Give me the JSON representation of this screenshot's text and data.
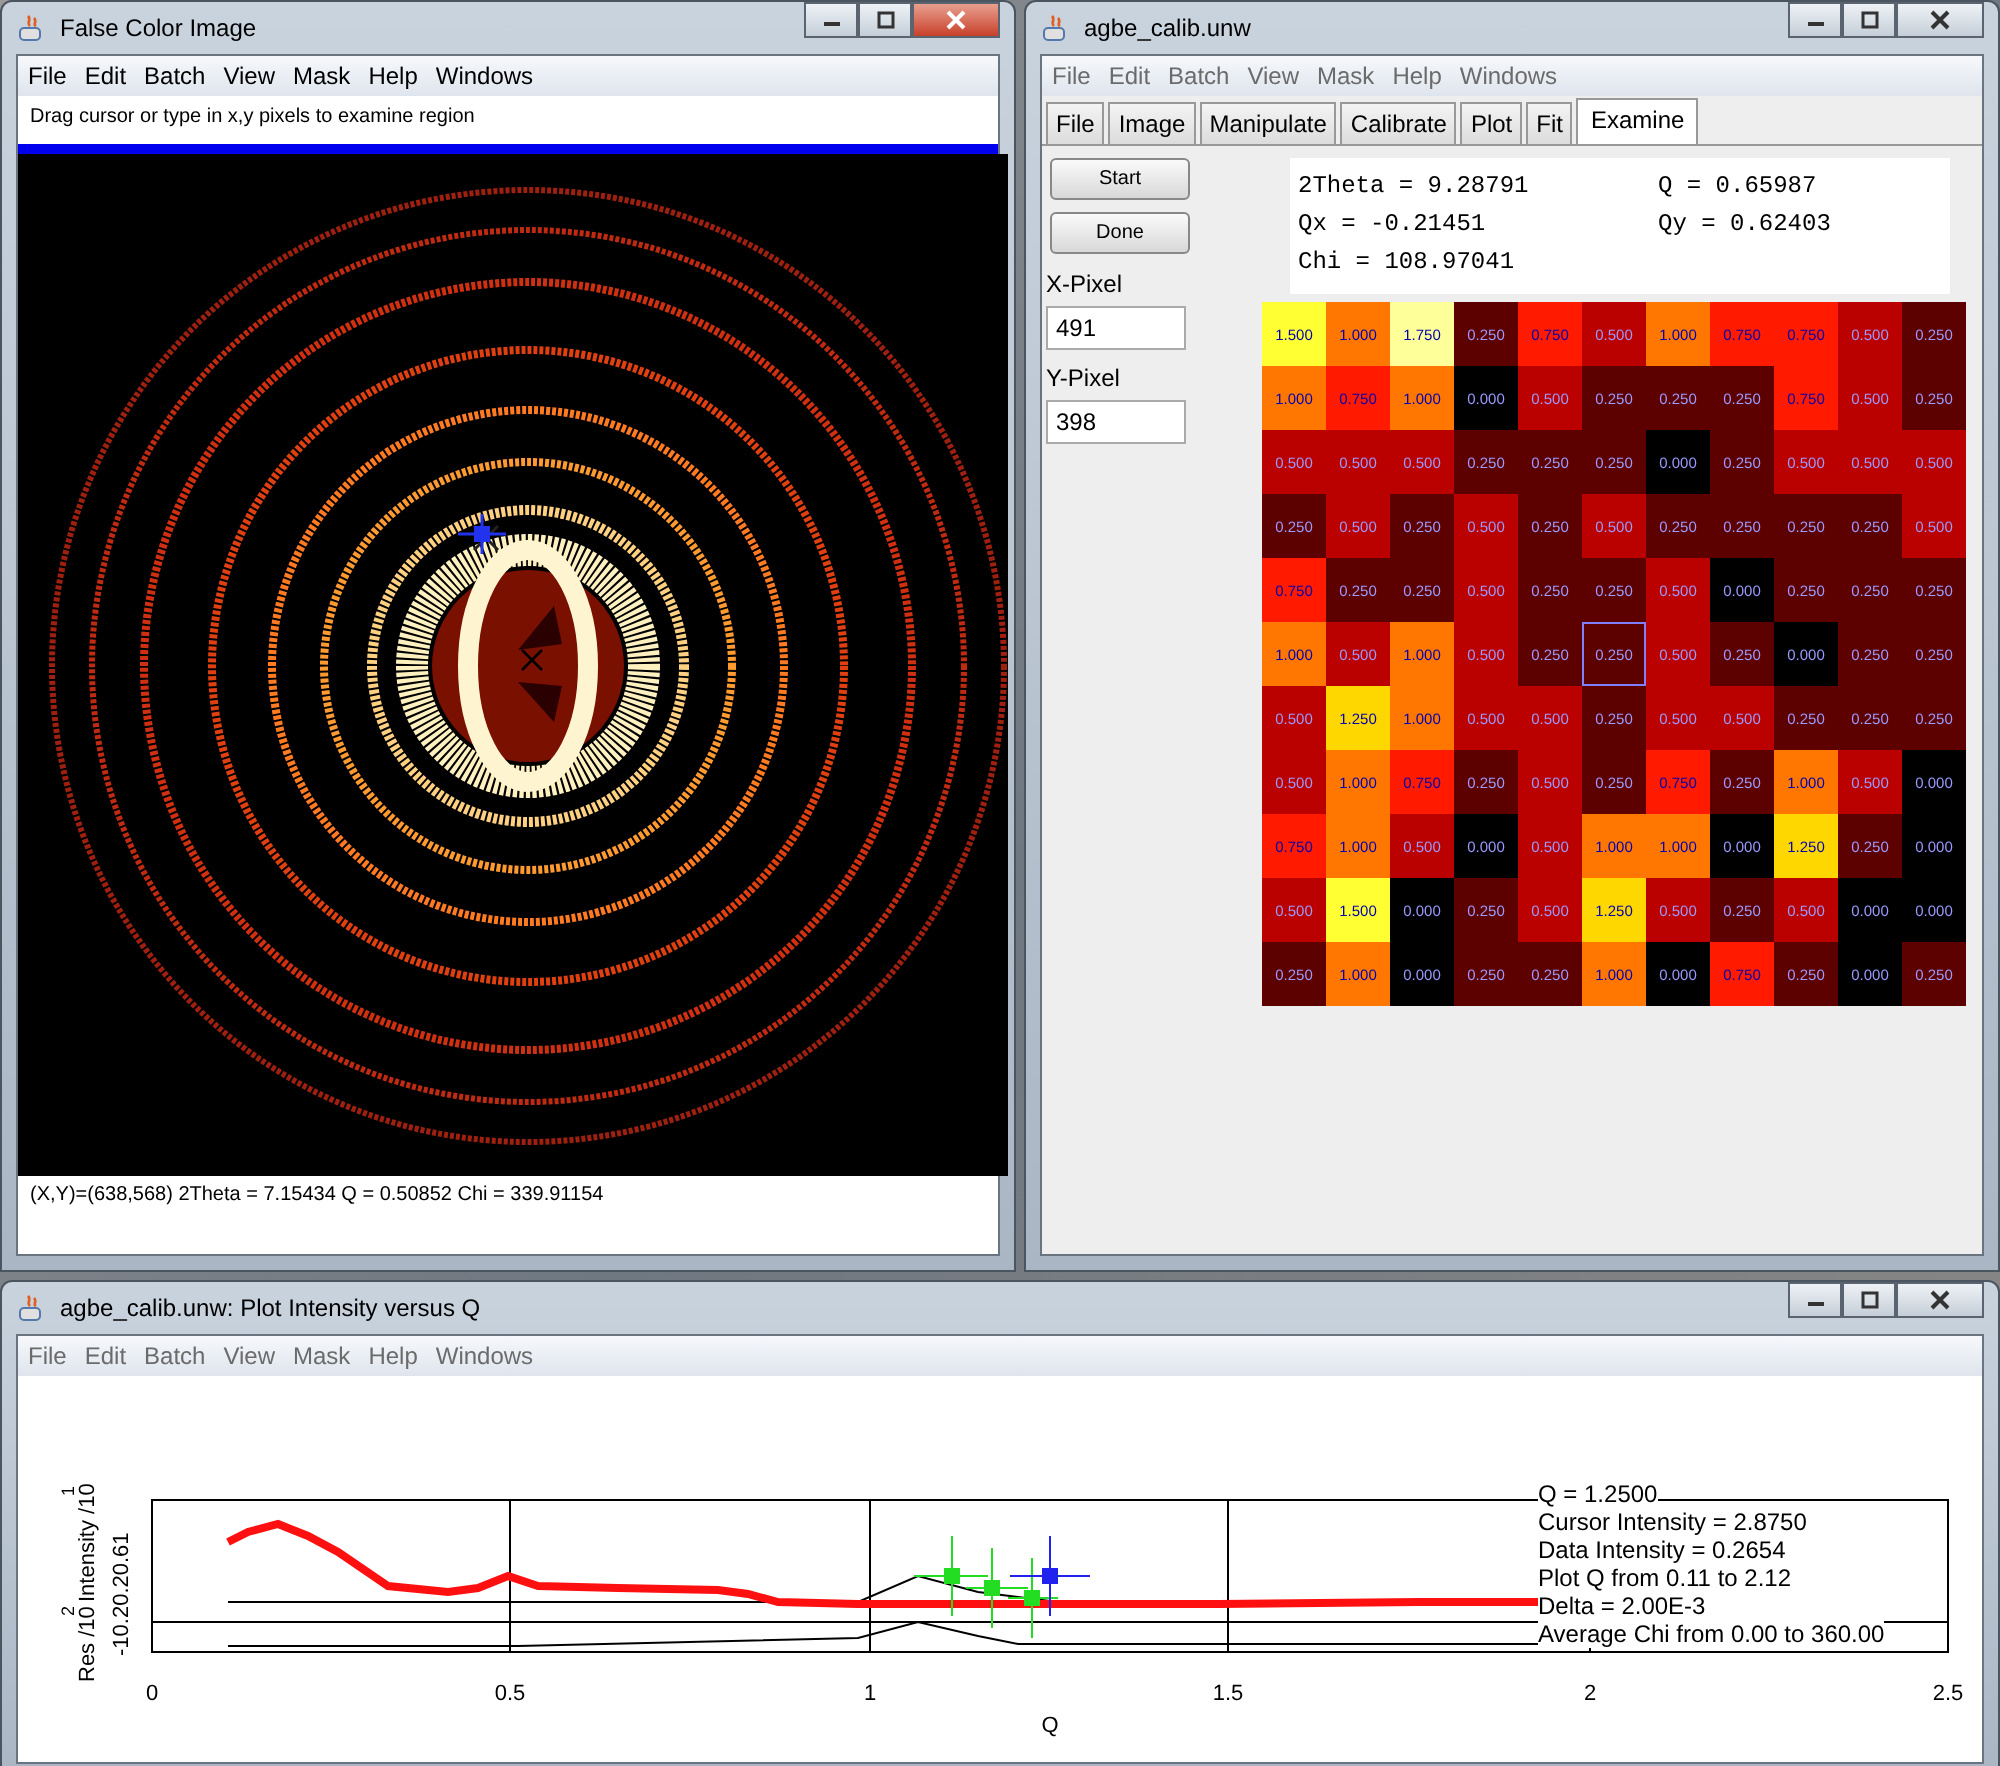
{
  "image_window": {
    "title": "False Color Image",
    "active": true,
    "menu": [
      "File",
      "Edit",
      "Batch",
      "View",
      "Mask",
      "Help",
      "Windows"
    ],
    "hint": "Drag cursor or type in x,y pixels to examine region",
    "status": "(X,Y)=(638,568)  2Theta = 7.15434 Q = 0.50852 Chi = 339.91154"
  },
  "examine_window": {
    "title": "agbe_calib.unw",
    "active": false,
    "menu": [
      "File",
      "Edit",
      "Batch",
      "View",
      "Mask",
      "Help",
      "Windows"
    ],
    "tabs": [
      {
        "label": "File",
        "selected": false
      },
      {
        "label": "Image",
        "selected": false
      },
      {
        "label": "Manipulate",
        "selected": false
      },
      {
        "label": "Calibrate",
        "selected": false
      },
      {
        "label": "Plot",
        "selected": false
      },
      {
        "label": "Fit",
        "selected": false
      },
      {
        "label": "Examine",
        "selected": true
      }
    ],
    "buttons": [
      "Start",
      "Done"
    ],
    "fields": [
      {
        "label": "X-Pixel",
        "value": "491"
      },
      {
        "label": "Y-Pixel",
        "value": "398"
      }
    ],
    "readout": [
      [
        "2Theta = 9.28791",
        "Q = 0.65987"
      ],
      [
        "Qx = -0.21451",
        "Qy = 0.62403"
      ],
      [
        "Chi = 108.97041"
      ]
    ],
    "grid": [
      [
        {
          "value": "1.500",
          "selected": false
        },
        {
          "value": "1.000",
          "selected": false
        },
        {
          "value": "1.750",
          "selected": false
        },
        {
          "value": "0.250",
          "selected": false
        },
        {
          "value": "0.750",
          "selected": false
        },
        {
          "value": "0.500",
          "selected": false
        },
        {
          "value": "1.000",
          "selected": false
        },
        {
          "value": "0.750",
          "selected": false
        },
        {
          "value": "0.750",
          "selected": false
        },
        {
          "value": "0.500",
          "selected": false
        },
        {
          "value": "0.250",
          "selected": false
        }
      ],
      [
        {
          "value": "1.000",
          "selected": false
        },
        {
          "value": "0.750",
          "selected": false
        },
        {
          "value": "1.000",
          "selected": false
        },
        {
          "value": "0.000",
          "selected": false
        },
        {
          "value": "0.500",
          "selected": false
        },
        {
          "value": "0.250",
          "selected": false
        },
        {
          "value": "0.250",
          "selected": false
        },
        {
          "value": "0.250",
          "selected": false
        },
        {
          "value": "0.750",
          "selected": false
        },
        {
          "value": "0.500",
          "selected": false
        },
        {
          "value": "0.250",
          "selected": false
        }
      ],
      [
        {
          "value": "0.500",
          "selected": false
        },
        {
          "value": "0.500",
          "selected": false
        },
        {
          "value": "0.500",
          "selected": false
        },
        {
          "value": "0.250",
          "selected": false
        },
        {
          "value": "0.250",
          "selected": false
        },
        {
          "value": "0.250",
          "selected": false
        },
        {
          "value": "0.000",
          "selected": false
        },
        {
          "value": "0.250",
          "selected": false
        },
        {
          "value": "0.500",
          "selected": false
        },
        {
          "value": "0.500",
          "selected": false
        },
        {
          "value": "0.500",
          "selected": false
        }
      ],
      [
        {
          "value": "0.250",
          "selected": false
        },
        {
          "value": "0.500",
          "selected": false
        },
        {
          "value": "0.250",
          "selected": false
        },
        {
          "value": "0.500",
          "selected": false
        },
        {
          "value": "0.250",
          "selected": false
        },
        {
          "value": "0.500",
          "selected": false
        },
        {
          "value": "0.250",
          "selected": false
        },
        {
          "value": "0.250",
          "selected": false
        },
        {
          "value": "0.250",
          "selected": false
        },
        {
          "value": "0.250",
          "selected": false
        },
        {
          "value": "0.500",
          "selected": false
        }
      ],
      [
        {
          "value": "0.750",
          "selected": false
        },
        {
          "value": "0.250",
          "selected": false
        },
        {
          "value": "0.250",
          "selected": false
        },
        {
          "value": "0.500",
          "selected": false
        },
        {
          "value": "0.250",
          "selected": false
        },
        {
          "value": "0.250",
          "selected": false
        },
        {
          "value": "0.500",
          "selected": false
        },
        {
          "value": "0.000",
          "selected": false
        },
        {
          "value": "0.250",
          "selected": false
        },
        {
          "value": "0.250",
          "selected": false
        },
        {
          "value": "0.250",
          "selected": false
        }
      ],
      [
        {
          "value": "1.000",
          "selected": false
        },
        {
          "value": "0.500",
          "selected": false
        },
        {
          "value": "1.000",
          "selected": false
        },
        {
          "value": "0.500",
          "selected": false
        },
        {
          "value": "0.250",
          "selected": false
        },
        {
          "value": "0.250",
          "selected": true
        },
        {
          "value": "0.500",
          "selected": false
        },
        {
          "value": "0.250",
          "selected": false
        },
        {
          "value": "0.000",
          "selected": false
        },
        {
          "value": "0.250",
          "selected": false
        },
        {
          "value": "0.250",
          "selected": false
        }
      ],
      [
        {
          "value": "0.500",
          "selected": false
        },
        {
          "value": "1.250",
          "selected": false
        },
        {
          "value": "1.000",
          "selected": false
        },
        {
          "value": "0.500",
          "selected": false
        },
        {
          "value": "0.500",
          "selected": false
        },
        {
          "value": "0.250",
          "selected": false
        },
        {
          "value": "0.500",
          "selected": false
        },
        {
          "value": "0.500",
          "selected": false
        },
        {
          "value": "0.250",
          "selected": false
        },
        {
          "value": "0.250",
          "selected": false
        },
        {
          "value": "0.250",
          "selected": false
        }
      ],
      [
        {
          "value": "0.500",
          "selected": false
        },
        {
          "value": "1.000",
          "selected": false
        },
        {
          "value": "0.750",
          "selected": false
        },
        {
          "value": "0.250",
          "selected": false
        },
        {
          "value": "0.500",
          "selected": false
        },
        {
          "value": "0.250",
          "selected": false
        },
        {
          "value": "0.750",
          "selected": false
        },
        {
          "value": "0.250",
          "selected": false
        },
        {
          "value": "1.000",
          "selected": false
        },
        {
          "value": "0.500",
          "selected": false
        },
        {
          "value": "0.000",
          "selected": false
        }
      ],
      [
        {
          "value": "0.750",
          "selected": false
        },
        {
          "value": "1.000",
          "selected": false
        },
        {
          "value": "0.500",
          "selected": false
        },
        {
          "value": "0.000",
          "selected": false
        },
        {
          "value": "0.500",
          "selected": false
        },
        {
          "value": "1.000",
          "selected": false
        },
        {
          "value": "1.000",
          "selected": false
        },
        {
          "value": "0.000",
          "selected": false
        },
        {
          "value": "1.250",
          "selected": false
        },
        {
          "value": "0.250",
          "selected": false
        },
        {
          "value": "0.000",
          "selected": false
        }
      ],
      [
        {
          "value": "0.500",
          "selected": false
        },
        {
          "value": "1.500",
          "selected": false
        },
        {
          "value": "0.000",
          "selected": false
        },
        {
          "value": "0.250",
          "selected": false
        },
        {
          "value": "0.500",
          "selected": false
        },
        {
          "value": "1.250",
          "selected": false
        },
        {
          "value": "0.500",
          "selected": false
        },
        {
          "value": "0.250",
          "selected": false
        },
        {
          "value": "0.500",
          "selected": false
        },
        {
          "value": "0.000",
          "selected": false
        },
        {
          "value": "0.000",
          "selected": false
        }
      ],
      [
        {
          "value": "0.250",
          "selected": false
        },
        {
          "value": "1.000",
          "selected": false
        },
        {
          "value": "0.000",
          "selected": false
        },
        {
          "value": "0.250",
          "selected": false
        },
        {
          "value": "0.250",
          "selected": false
        },
        {
          "value": "1.000",
          "selected": false
        },
        {
          "value": "0.000",
          "selected": false
        },
        {
          "value": "0.750",
          "selected": false
        },
        {
          "value": "0.250",
          "selected": false
        },
        {
          "value": "0.000",
          "selected": false
        },
        {
          "value": "0.250",
          "selected": false
        }
      ]
    ]
  },
  "plot_window": {
    "title": "agbe_calib.unw: Plot Intensity versus Q",
    "active": false,
    "menu": [
      "File",
      "Edit",
      "Batch",
      "View",
      "Mask",
      "Help",
      "Windows"
    ],
    "y_labels": [
      "Res /10",
      "Intensity /10",
      "2",
      "1"
    ],
    "y_ticks": "-10.20.20.61",
    "x_ticks": [
      "0",
      "0.5",
      "1",
      "1.5",
      "2",
      "2.5"
    ],
    "xlabel": "Q",
    "info": [
      "Q = 1.2500",
      "Cursor Intensity = 2.8750",
      "Data Intensity = 0.2654",
      "Plot Q from 0.11 to 2.12",
      "Delta = 2.00E-3",
      "Average Chi from 0.00 to 360.00"
    ]
  }
}
